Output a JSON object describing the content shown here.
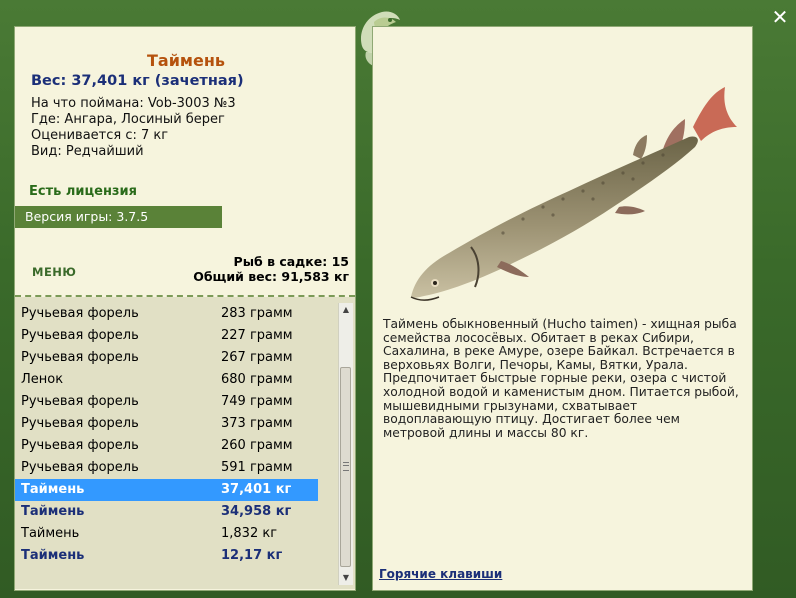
{
  "fish": {
    "name": "Таймень",
    "weight_line": "Вес: 37,401 кг (зачетная)",
    "caught_with": "На что поймана: Vob-3003 №3",
    "location": "Где: Ангара, Лосиный берег",
    "rated_from": "Оценивается с: 7 кг",
    "category": "Вид: Редчайший"
  },
  "license_text": "Есть лицензия",
  "version_text": "Версия игры: 3.7.5",
  "menu_label": "МЕНЮ",
  "summary": {
    "fish_in_keepnet": "Рыб в садке: 15",
    "total_weight": "Общий вес: 91,583 кг"
  },
  "catch_list": [
    {
      "name": "Ручьевая форель",
      "weight": "283 грамм",
      "style": "normal"
    },
    {
      "name": "Ручьевая форель",
      "weight": "227 грамм",
      "style": "normal"
    },
    {
      "name": "Ручьевая форель",
      "weight": "267 грамм",
      "style": "normal"
    },
    {
      "name": "Ленок",
      "weight": "680 грамм",
      "style": "normal"
    },
    {
      "name": "Ручьевая форель",
      "weight": "749 грамм",
      "style": "normal"
    },
    {
      "name": "Ручьевая форель",
      "weight": "373 грамм",
      "style": "normal"
    },
    {
      "name": "Ручьевая форель",
      "weight": "260 грамм",
      "style": "normal"
    },
    {
      "name": "Ручьевая форель",
      "weight": "591 грамм",
      "style": "normal"
    },
    {
      "name": "Таймень",
      "weight": "37,401 кг",
      "style": "selected"
    },
    {
      "name": "Таймень",
      "weight": "34,958 кг",
      "style": "trophy"
    },
    {
      "name": "Таймень",
      "weight": "1,832 кг",
      "style": "normal"
    },
    {
      "name": "Таймень",
      "weight": "12,17 кг",
      "style": "trophy"
    }
  ],
  "description": "Таймень обыкновенный (Hucho taimen) - хищная рыба семейства лососёвых. Обитает в реках Сибири, Сахалина, в реке Амуре, озере Байкал. Встречается в верховьях Волги, Печоры, Камы, Вятки, Урала. Предпочитает быстрые горные реки, озера с чистой холодной водой и каменистым дном. Питается рыбой, мышевидными грызунами, схватывает водоплавающую птицу. Достигает более чем метровой длины и массы 80 кг.",
  "hotkeys_label": "Горячие клавиши",
  "icons": {
    "close": "close-icon",
    "logo": "fish-logo-icon",
    "scroll_up": "scroll-up-icon",
    "scroll_down": "scroll-down-icon"
  },
  "colors": {
    "frame": "#3d6b2c",
    "panel": "#f6f4dd",
    "list_bg": "#e1e0c5",
    "title": "#b5520d",
    "accent_text": "#1b2f78",
    "selection": "#3399ff",
    "license": "#2a6b1a"
  }
}
